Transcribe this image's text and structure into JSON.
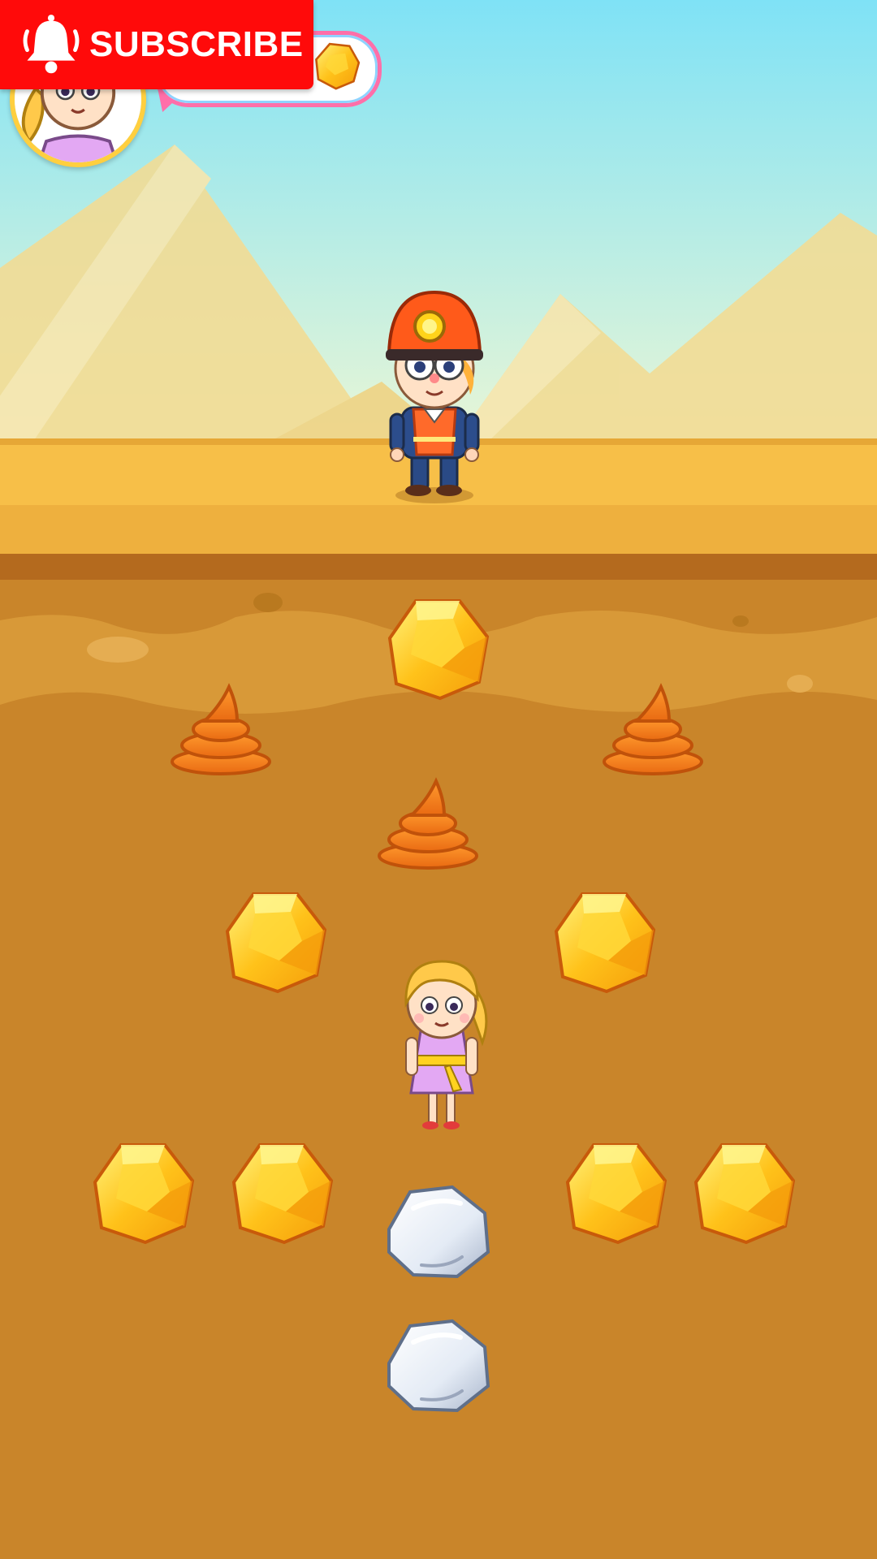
{
  "subscribe_button": {
    "label": "SUBSCRIBE"
  },
  "colors": {
    "sky_top": "#7fe2f6",
    "sky_bottom": "#e9f6d6",
    "dunes": "#f3dc95",
    "sand_ground": "#f7bf48",
    "dirt": "#c9852a",
    "gold": "#ffc21a",
    "poop": "#f07a18",
    "stone": "#e4ebf5",
    "subscribe_red": "#ff0a0a"
  },
  "hud": {
    "avatar": "girl-avatar-icon",
    "speech_bubble_item": "gold-nugget-icon"
  },
  "characters": {
    "surface": "miner-character",
    "underground": "girl-character"
  },
  "buried_items": [
    {
      "type": "gold",
      "name": "gold-nugget-icon"
    },
    {
      "type": "poop",
      "name": "poop-icon"
    },
    {
      "type": "poop",
      "name": "poop-icon"
    },
    {
      "type": "poop",
      "name": "poop-icon"
    },
    {
      "type": "gold",
      "name": "gold-nugget-icon"
    },
    {
      "type": "gold",
      "name": "gold-nugget-icon"
    },
    {
      "type": "gold",
      "name": "gold-nugget-icon"
    },
    {
      "type": "gold",
      "name": "gold-nugget-icon"
    },
    {
      "type": "stone",
      "name": "stone-icon"
    },
    {
      "type": "gold",
      "name": "gold-nugget-icon"
    },
    {
      "type": "gold",
      "name": "gold-nugget-icon"
    },
    {
      "type": "stone",
      "name": "stone-icon"
    }
  ]
}
